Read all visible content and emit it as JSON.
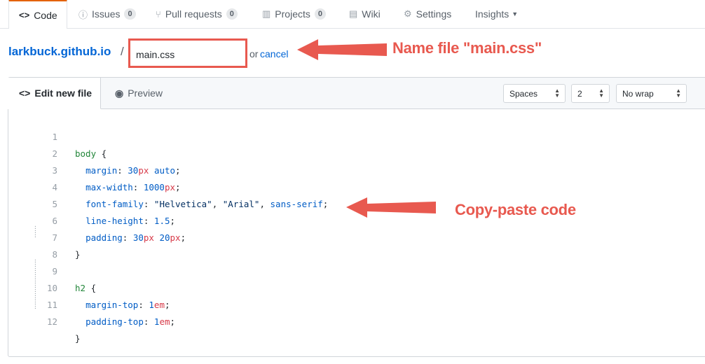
{
  "nav": {
    "tabs": [
      {
        "label": "Code",
        "icon": "code-icon",
        "selected": true
      },
      {
        "label": "Issues",
        "icon": "issue-icon",
        "count": "0"
      },
      {
        "label": "Pull requests",
        "icon": "pull-request-icon",
        "count": "0"
      },
      {
        "label": "Projects",
        "icon": "project-icon",
        "count": "0"
      },
      {
        "label": "Wiki",
        "icon": "book-icon"
      },
      {
        "label": "Settings",
        "icon": "gear-icon"
      },
      {
        "label": "Insights",
        "icon": "chevron-down-icon"
      }
    ]
  },
  "breadcrumb": {
    "repo": "larkbuck.github.io",
    "separator": "/",
    "filename_value": "main.css",
    "or_text": "or",
    "cancel_label": "cancel"
  },
  "annotations": {
    "name_file": "Name file \"main.css\"",
    "copy_paste": "Copy-paste code",
    "color": "#e8594f"
  },
  "editor": {
    "tab_edit": "Edit new file",
    "tab_preview": "Preview",
    "indent_mode": "Spaces",
    "indent_size": "2",
    "wrap_mode": "No wrap",
    "lines": [
      {
        "n": "1"
      },
      {
        "n": "2"
      },
      {
        "n": "3"
      },
      {
        "n": "4"
      },
      {
        "n": "5"
      },
      {
        "n": "6"
      },
      {
        "n": "7"
      },
      {
        "n": "8"
      },
      {
        "n": "9"
      },
      {
        "n": "10"
      },
      {
        "n": "11"
      },
      {
        "n": "12"
      }
    ],
    "code": {
      "l1_sel": "body",
      "l1_brace": " {",
      "l2_prop": "margin",
      "l2_num": "30",
      "l2_unit": "px",
      "l2_kw": "auto",
      "l3_prop": "max-width",
      "l3_num": "1000",
      "l3_unit": "px",
      "l4_prop": "font-family",
      "l4_str1": "\"Helvetica\"",
      "l4_str2": "\"Arial\"",
      "l4_kw": "sans-serif",
      "l5_prop": "line-height",
      "l5_num": "1.5",
      "l6_prop": "padding",
      "l6_num1": "30",
      "l6_unit1": "px",
      "l6_num2": "20",
      "l6_unit2": "px",
      "l7": "}",
      "l9_sel": "h2",
      "l9_brace": " {",
      "l10_prop": "margin-top",
      "l10_num": "1",
      "l10_unit": "em",
      "l11_prop": "padding-top",
      "l11_num": "1",
      "l11_unit": "em",
      "l12": "}"
    }
  }
}
